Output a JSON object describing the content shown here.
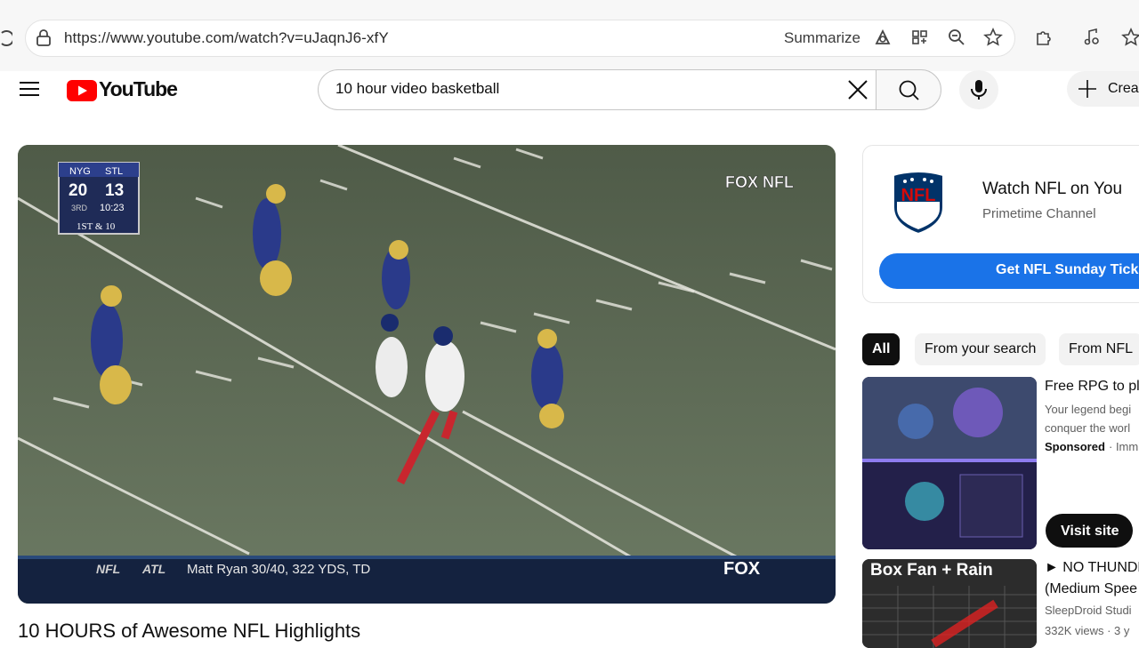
{
  "browser": {
    "url": "https://www.youtube.com/watch?v=uJaqnJ6-xfY",
    "summarize_label": "Summarize"
  },
  "youtube": {
    "logo_text": "YouTube",
    "search_query": "10 hour video basketball",
    "create_label": "Crea"
  },
  "video": {
    "title": "10 HOURS of Awesome NFL Highlights",
    "scorebug": {
      "team1": "NYG",
      "team2": "STL",
      "score1": "20",
      "score2": "13",
      "quarter": "3RD",
      "clock": "10:23",
      "down": "1ST & 10"
    },
    "network_logo": "FOX NFL",
    "ticker": {
      "league": "NFL",
      "team": "ATL",
      "text": "Matt Ryan 30/40, 322 YDS, TD",
      "network": "FOX"
    }
  },
  "ad": {
    "brand": "NFL",
    "title": "Watch NFL on You",
    "subtitle": "Primetime Channel",
    "cta": "Get NFL Sunday Ticke"
  },
  "chips": [
    "All",
    "From your search",
    "From NFL"
  ],
  "recommendations": [
    {
      "title": "Free RPG to pl",
      "desc_line1": "Your legend begi",
      "desc_line2": "conquer the worl",
      "sponsored": "Sponsored",
      "advertiser": "· Imm",
      "button": "Visit site"
    },
    {
      "thumb_text": "Box Fan + Rain",
      "title_line1": "► NO THUNDE",
      "title_line2": "(Medium Spee",
      "channel": "SleepDroid Studi",
      "views": "332K views · 3 y"
    }
  ],
  "colors": {
    "yt_red": "#ff0000",
    "cta_blue": "#1a73e8",
    "field_green": "#5d6a55"
  }
}
